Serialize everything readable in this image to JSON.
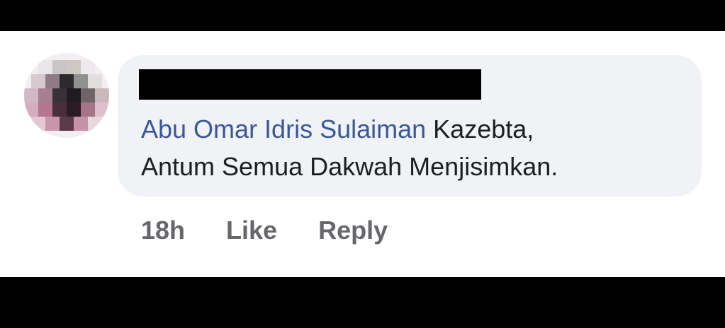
{
  "comment": {
    "author": "Abu Omar Idris Sulaiman",
    "text_line1": " Kazebta,",
    "text_line2": "Antum Semua Dakwah Menjisimkan."
  },
  "actions": {
    "timestamp": "18h",
    "like_label": "Like",
    "reply_label": "Reply"
  },
  "colors": {
    "author_link": "#385898",
    "bubble_bg": "#f0f2f5",
    "action_text": "#65676b"
  }
}
